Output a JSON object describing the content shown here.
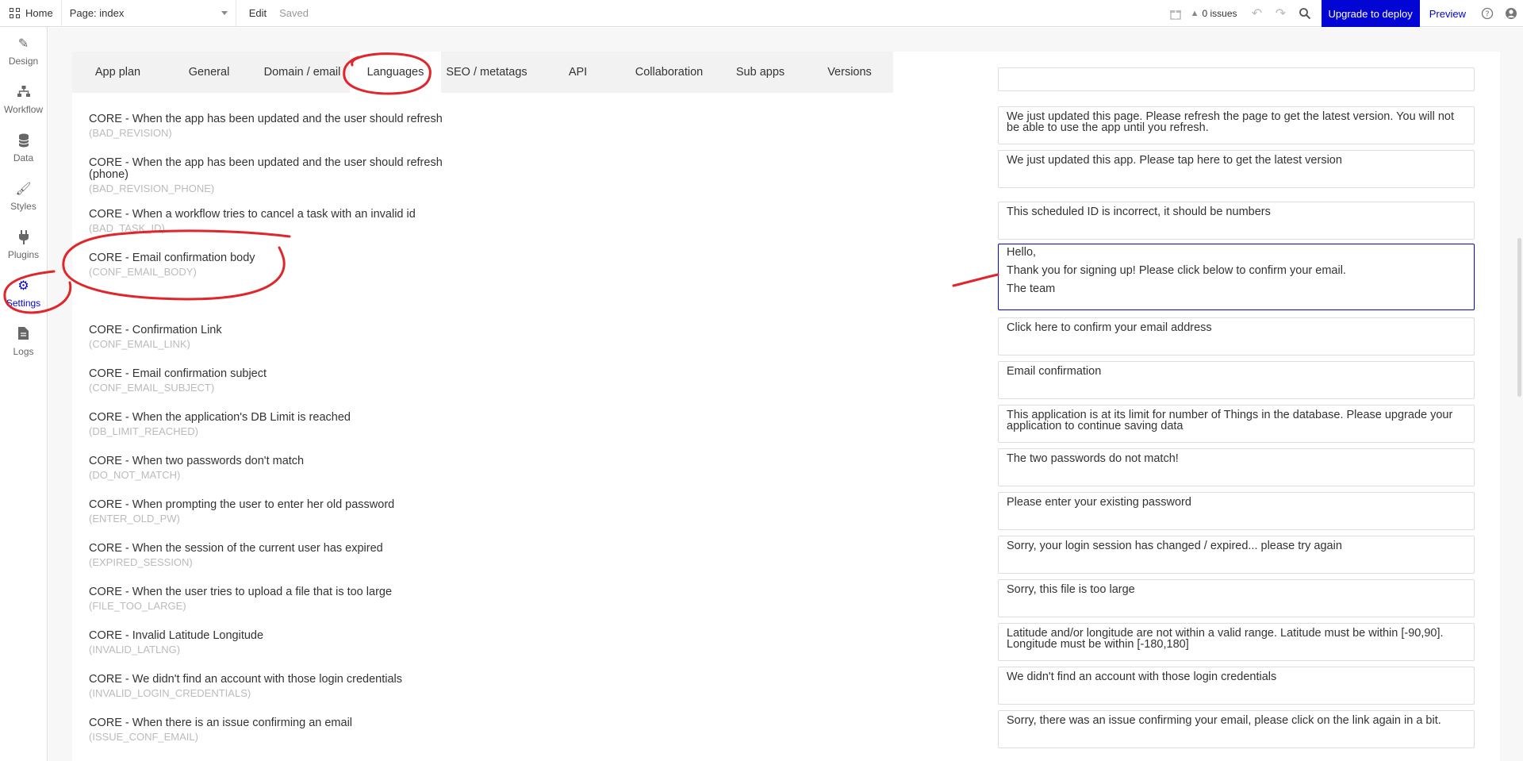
{
  "topbar": {
    "home_label": "Home",
    "page_select": "Page: index",
    "edit_label": "Edit",
    "saved_label": "Saved",
    "issues_label": "0 issues",
    "upgrade_label": "Upgrade to deploy",
    "preview_label": "Preview"
  },
  "sidebar": {
    "items": [
      {
        "label": "Design",
        "icon": "design-icon"
      },
      {
        "label": "Workflow",
        "icon": "workflow-icon"
      },
      {
        "label": "Data",
        "icon": "database-icon"
      },
      {
        "label": "Styles",
        "icon": "brush-icon"
      },
      {
        "label": "Plugins",
        "icon": "plug-icon"
      },
      {
        "label": "Settings",
        "icon": "gear-icon"
      },
      {
        "label": "Logs",
        "icon": "document-icon"
      }
    ],
    "active": "Settings"
  },
  "tabs": [
    "App plan",
    "General",
    "Domain / email",
    "Languages",
    "SEO / metatags",
    "API",
    "Collaboration",
    "Sub apps",
    "Versions"
  ],
  "active_tab": "Languages",
  "rows": [
    {
      "label": "CORE - When the app has been updated and the user should refresh",
      "code": "(BAD_REVISION)",
      "value": "We just updated this page.  Please refresh the page to get the latest version. You will not be able to use the app until you refresh."
    },
    {
      "label": "CORE - When the app has been updated and the user should refresh (phone)",
      "code": "(BAD_REVISION_PHONE)",
      "value": "We just updated this app. Please tap here to get the latest version"
    },
    {
      "label": "CORE - When a workflow tries to cancel a task with an invalid id",
      "code": "(BAD_TASK_ID)",
      "value": "This scheduled ID is incorrect, it should be numbers"
    },
    {
      "label": "CORE - Email confirmation body",
      "code": "(CONF_EMAIL_BODY)",
      "value_lines": [
        "Hello,",
        "Thank you for signing up! Please click below to confirm your email.",
        "The team"
      ]
    },
    {
      "label": "CORE - Confirmation Link",
      "code": "(CONF_EMAIL_LINK)",
      "value": "Click here to confirm your email address"
    },
    {
      "label": "CORE - Email confirmation subject",
      "code": "(CONF_EMAIL_SUBJECT)",
      "value": "Email confirmation"
    },
    {
      "label": "CORE - When the application's DB Limit is reached",
      "code": "(DB_LIMIT_REACHED)",
      "value": "This application is at its limit for number of Things in the database. Please upgrade your application to continue saving data"
    },
    {
      "label": "CORE - When two passwords don't match",
      "code": "(DO_NOT_MATCH)",
      "value": "The two passwords do not match!"
    },
    {
      "label": "CORE - When prompting the user to enter her old password",
      "code": "(ENTER_OLD_PW)",
      "value": "Please enter your existing password"
    },
    {
      "label": "CORE - When the session of the current user has expired",
      "code": "(EXPIRED_SESSION)",
      "value": "Sorry, your login session has changed / expired... please try again"
    },
    {
      "label": "CORE - When the user tries to upload a file that is too large",
      "code": "(FILE_TOO_LARGE)",
      "value": "Sorry, this file is too large"
    },
    {
      "label": "CORE - Invalid Latitude Longitude",
      "code": "(INVALID_LATLNG)",
      "value": "Latitude and/or longitude are not within a valid range. Latitude must be within [-90,90]. Longitude must be within [-180,180]"
    },
    {
      "label": "CORE - We didn't find an account with those login credentials",
      "code": "(INVALID_LOGIN_CREDENTIALS)",
      "value": "We didn't find an account with those login credentials"
    },
    {
      "label": "CORE - When there is an issue confirming an email",
      "code": "(ISSUE_CONF_EMAIL)",
      "value": "Sorry, there was an issue confirming your email, please click on the link again in a bit."
    }
  ],
  "colors": {
    "accent": "#0205d3",
    "annotation": "#e0262b"
  }
}
